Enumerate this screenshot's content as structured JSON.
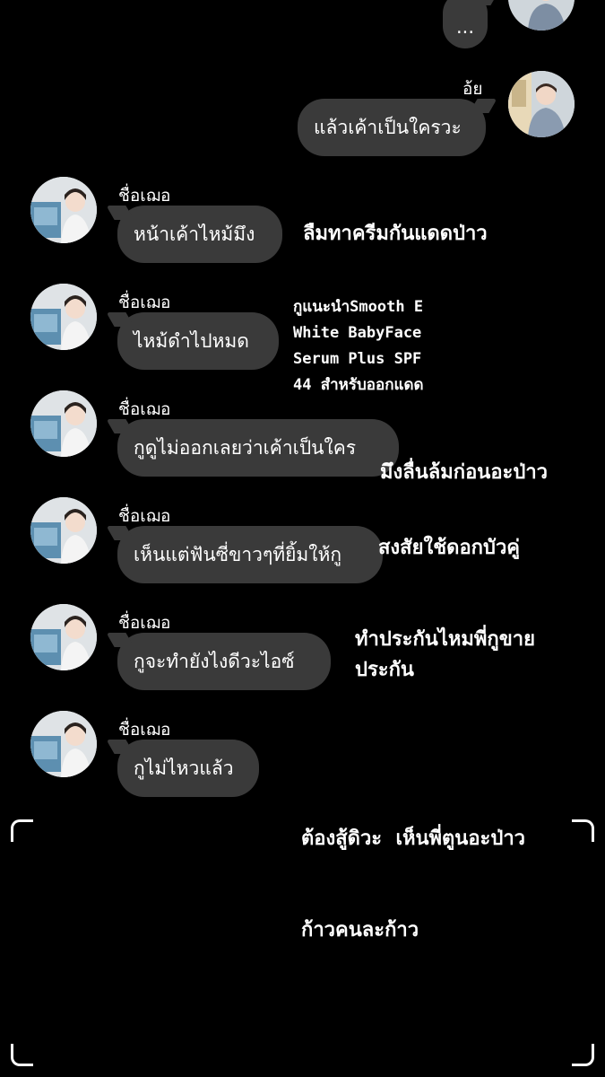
{
  "chat": {
    "top_bubble": "...",
    "sender_me": "อ้ย",
    "me_message": "แล้วเค้าเป็นใครวะ",
    "messages": [
      {
        "name": "ชื่อเฌอ",
        "text": "หน้าเค้าไหม้มึง"
      },
      {
        "name": "ชื่อเฌอ",
        "text": "ไหม้ดำไปหมด"
      },
      {
        "name": "ชื่อเฌอ",
        "text": "กูดูไม่ออกเลยว่าเค้าเป็นใคร"
      },
      {
        "name": "ชื่อเฌอ",
        "text": "เห็นแต่ฟันซี่ขาวๆที่ยิ้มให้กู"
      },
      {
        "name": "ชื่อเฌอ",
        "text": "กูจะทำยังไงดีวะไอซ์"
      },
      {
        "name": "ชื่อเฌอ",
        "text": "กูไม่ไหวแล้ว"
      }
    ]
  },
  "annotations": {
    "a1": "ลืมทาครีมกันแดดป่าว",
    "a2": {
      "line1_thai": "กูแนะนำ",
      "line1_latin": "Smooth E",
      "line2": "White BabyFace",
      "line3": "Serum Plus SPF",
      "line4_num": "44 ",
      "line4_thai": "สำหรับออกแดด"
    },
    "a3": "มึงลื่นล้มก่อนอะป่าว",
    "a4": "สงสัยใช้ดอกบัวคู่",
    "a5": {
      "line1": "ทำประกันไหมพี่กูขาย",
      "line2": "ประกัน"
    },
    "a6": {
      "line1": "ต้องสู้ดิวะ  เห็นพี่ตูนอะป่าว",
      "line2": "ก้าวคนละก้าว"
    }
  }
}
